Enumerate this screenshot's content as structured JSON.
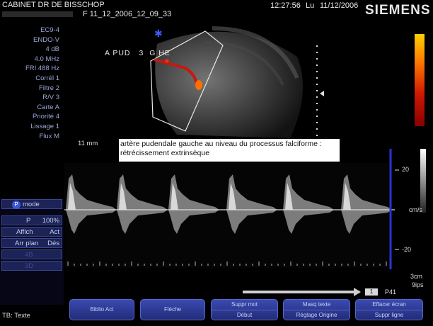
{
  "header": {
    "clinic": "CABINET DR DE BISSCHOP",
    "file_id": "F   11_12_2006_12_09_33",
    "time": "12:27:56",
    "day": "Lu",
    "date": "11/12/2006",
    "brand": "SIEMENS"
  },
  "params": [
    "EC9-4",
    "ENDO-V",
    "4 dB",
    "4.0 MHz",
    "FRI 488 Hz",
    "Corrél 1",
    "Filtre 2",
    "R/V 3",
    "Carte A",
    "Priorité 4",
    "Lissage 1",
    "Flux M"
  ],
  "image": {
    "label_prefix": "A PUD",
    "label_suffix": "G HE",
    "depth_label": "11 mm"
  },
  "annotation": "artère pudendale gauche au niveau du processus falciforme : rétrécissement extrinsèque",
  "spectral": {
    "scale_top": "20",
    "baseline_unit": "cm/s",
    "scale_bottom": "-20",
    "depth": "3cm",
    "speed": "9ips",
    "page_badge": "1",
    "page_label": "P41"
  },
  "left_panel": {
    "mode_icon": "P",
    "mode_label": "mode",
    "row1_left": "P",
    "row1_right": "100%",
    "row2_left": "Affich",
    "row2_right": "Act",
    "row3_left": "Arr plan",
    "row3_right": "Dés",
    "row4": "4B",
    "row5": "3D"
  },
  "status": "TB: Texte",
  "softkeys": [
    {
      "single": "Biblio Act"
    },
    {
      "single": "Flèche"
    },
    {
      "top": "Suppr mot",
      "bottom": "Début"
    },
    {
      "top": "Masq texte",
      "bottom": "Réglage Origine"
    },
    {
      "top": "Effacer écran",
      "bottom": "Suppr ligne"
    }
  ],
  "colors": {
    "panel_button": "#1c2356",
    "softkey": "#2e3a9c",
    "doppler_red": "#d02010",
    "doppler_orange": "#ff8a00"
  }
}
